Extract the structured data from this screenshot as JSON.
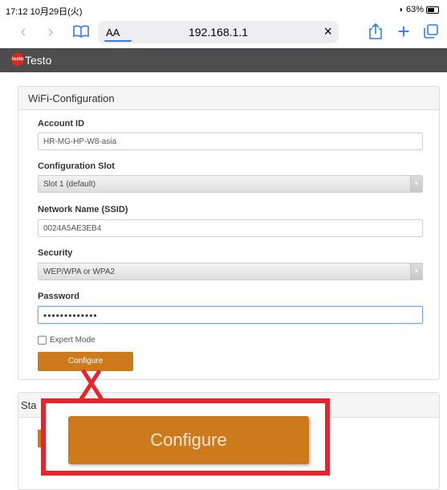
{
  "status_bar": {
    "time": "17:12",
    "date": "10月29日(火)",
    "battery": "63%"
  },
  "safari": {
    "text_size_label": "AA",
    "url": "192.168.1.1",
    "clear_glyph": "×"
  },
  "app": {
    "brand": "Testo",
    "logo_text": "testo"
  },
  "wifi_panel": {
    "title": "WiFi-Configuration",
    "account_id": {
      "label": "Account ID",
      "value": "HR-MG-HP-W8-asia"
    },
    "configuration_slot": {
      "label": "Configuration Slot",
      "value": "Slot 1 (default)"
    },
    "network_name": {
      "label": "Network Name (SSID)",
      "value": "0024A5AE3EB4"
    },
    "security": {
      "label": "Security",
      "value": "WEP/WPA or WPA2"
    },
    "password": {
      "label": "Password",
      "value": "•••••••••••••"
    },
    "expert_mode": {
      "label": "Expert Mode",
      "checked": false
    },
    "configure_button": "Configure"
  },
  "status_panel": {
    "title_visible": "Sta"
  },
  "callout": {
    "button_label": "Configure",
    "color": "#e8232b"
  },
  "colors": {
    "accent_orange": "#cc7a1c",
    "header_gray": "#4d4d4d",
    "ios_blue": "#2f7cf6"
  }
}
